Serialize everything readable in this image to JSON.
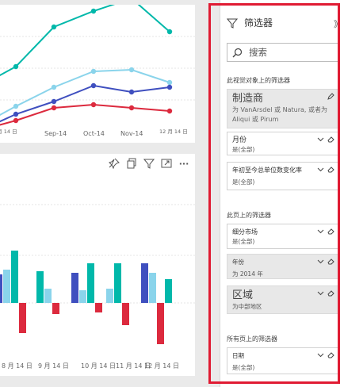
{
  "line_chart": {
    "x_labels": [
      "Sep-14",
      "Oct-14",
      "Nov-14"
    ],
    "partial_left_label": "8 月 14 日",
    "partial_right_label": "12 月 14 日",
    "series_colors": [
      "#01b8aa",
      "#8ad4eb",
      "#3f4fbf",
      "#dc2a3e"
    ]
  },
  "bar_chart": {
    "x_labels": [
      "8 月 14 日",
      "9 月 14 日",
      "10 月 14 日",
      "11 月 14 日",
      "12 月 14 日"
    ],
    "colors": {
      "blue": "#3f4fbf",
      "teal": "#01b8aa",
      "light": "#8ad4eb",
      "red": "#dc2a3e"
    }
  },
  "visual_toolbar": {
    "icons": [
      "pin-icon",
      "copy-icon",
      "filter-icon",
      "focus-mode-icon",
      "more-options-icon"
    ],
    "more": "···"
  },
  "filter_pane": {
    "title": "筛选器",
    "collapse_glyph": "》",
    "search_placeholder": "搜索",
    "section_visual": "此视觉对象上的筛选器",
    "section_page": "此页上的筛选器",
    "section_all_pages": "所有页上的筛选器",
    "visual_filters": [
      {
        "name": "制造商",
        "value": "为 VanArsdel 或 Natura, 或者为 Aliqui 或 Pirum"
      },
      {
        "name": "月份",
        "value": "是(全部)"
      },
      {
        "name": "年初至今总单位数变化率",
        "value": "是(全部)"
      }
    ],
    "page_filters": [
      {
        "name": "细分市场",
        "value": "是(全部)"
      },
      {
        "name": "年份",
        "value": "为 2014 年"
      },
      {
        "name": "区域",
        "value": "为中部地区"
      }
    ],
    "all_page_filters": [
      {
        "name": "日期",
        "value": "是(全部)"
      }
    ]
  }
}
